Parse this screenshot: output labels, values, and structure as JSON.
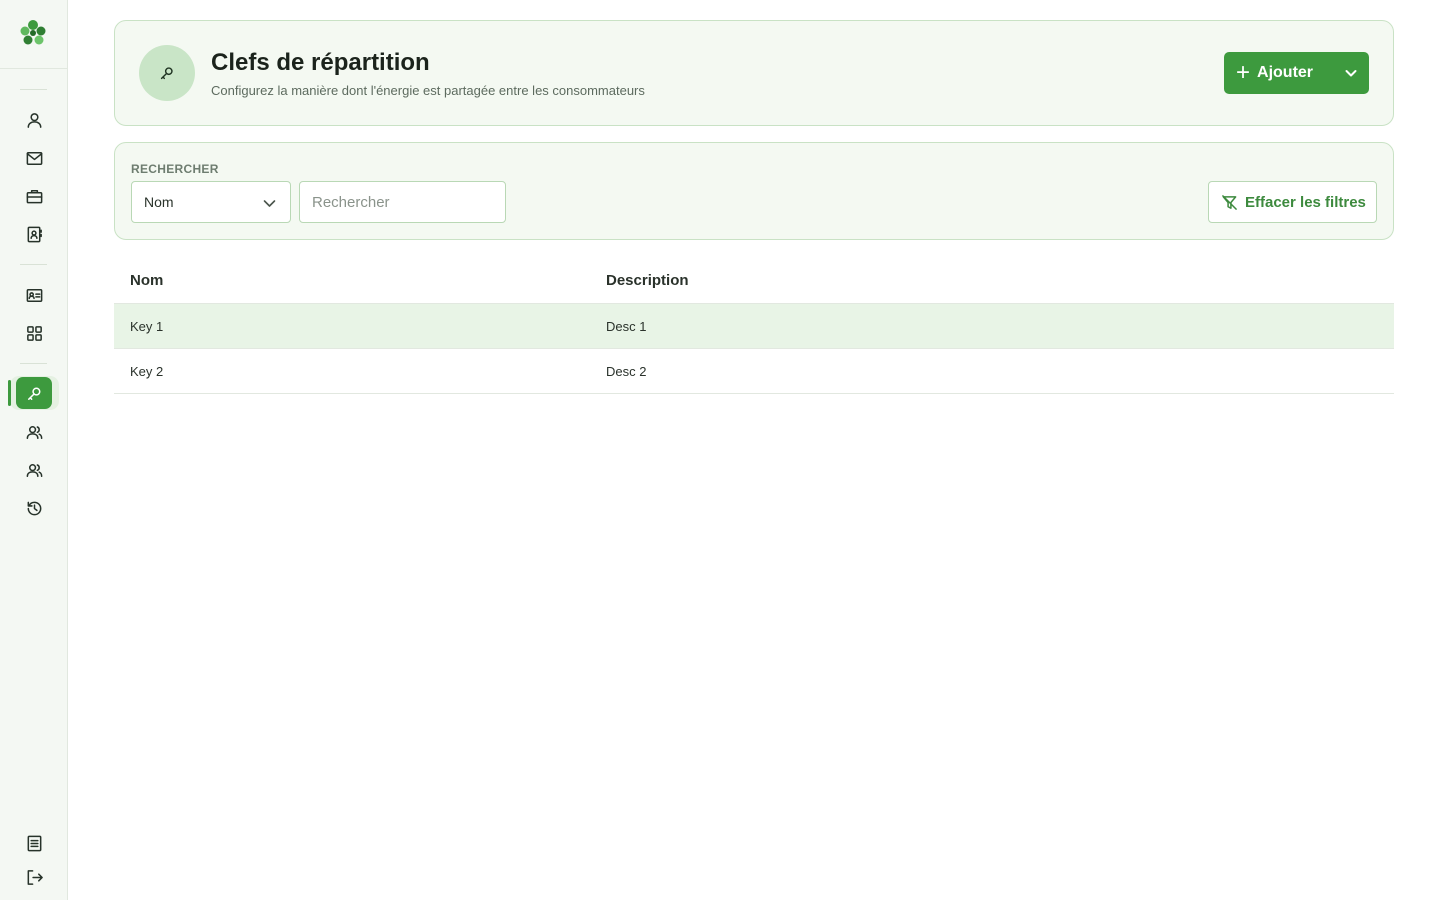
{
  "sidebar": {
    "logo_icon": "clover-logo-icon",
    "nav_items": [
      {
        "icon": "user-icon",
        "active": false
      },
      {
        "icon": "mail-icon",
        "active": false
      },
      {
        "icon": "briefcase-icon",
        "active": false
      },
      {
        "icon": "contact-book-icon",
        "active": false
      },
      {
        "icon": "id-card-icon",
        "active": false
      },
      {
        "icon": "grid-icon",
        "active": false
      },
      {
        "icon": "key-icon",
        "active": true
      },
      {
        "icon": "users-icon",
        "active": false
      },
      {
        "icon": "users-group-icon",
        "active": false
      },
      {
        "icon": "history-icon",
        "active": false
      },
      {
        "icon": "document-icon",
        "active": false
      },
      {
        "icon": "logout-icon",
        "active": false
      }
    ]
  },
  "header": {
    "icon": "key-icon",
    "title": "Clefs de répartition",
    "subtitle": "Configurez la manière dont l'énergie est partagée entre les consommateurs",
    "add_label": "Ajouter"
  },
  "filters": {
    "section_label": "RECHERCHER",
    "field_select_value": "Nom",
    "search_placeholder": "Rechercher",
    "search_value": "",
    "clear_label": "Effacer les filtres"
  },
  "table": {
    "columns": [
      "Nom",
      "Description"
    ],
    "rows": [
      {
        "name": "Key 1",
        "description": "Desc 1"
      },
      {
        "name": "Key 2",
        "description": "Desc 2"
      }
    ]
  },
  "colors": {
    "accent": "#3d9a3e",
    "card_bg": "#f4f9f2",
    "card_border": "#c9e2c5",
    "row_highlight": "#e8f4e6"
  }
}
